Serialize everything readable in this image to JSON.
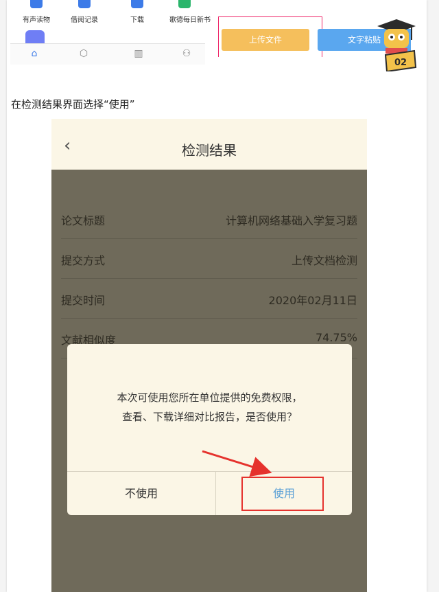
{
  "top_strip": {
    "grid_items": [
      "有声读物",
      "借阅记录",
      "下载",
      "歌德每日新书"
    ],
    "tabs": [
      "home-icon",
      "discover-icon",
      "library-icon",
      "profile-icon"
    ]
  },
  "upload": {
    "upload_label": "上传文件",
    "paste_label": "文字粘贴"
  },
  "badge": {
    "number": "02"
  },
  "caption": "在检测结果界面选择“使用”",
  "phone": {
    "title": "检测结果",
    "rows": [
      {
        "key": "论文标题",
        "value": "计算机网络基础入学复习题"
      },
      {
        "key": "提交方式",
        "value": "上传文档检测"
      },
      {
        "key": "提交时间",
        "value": "2020年02月11日"
      },
      {
        "key": "文献相似度",
        "value": "74.75%"
      }
    ],
    "dialog": {
      "line1": "本次可使用您所在单位提供的免费权限，",
      "line2": "查看、下载详细对比报告，是否使用？",
      "cancel": "不使用",
      "confirm": "使用"
    }
  },
  "colors": {
    "upload": "#f5bf5c",
    "paste": "#5aa7ef",
    "highlight": "#e5322d",
    "confirm_text": "#5aa0d6"
  }
}
